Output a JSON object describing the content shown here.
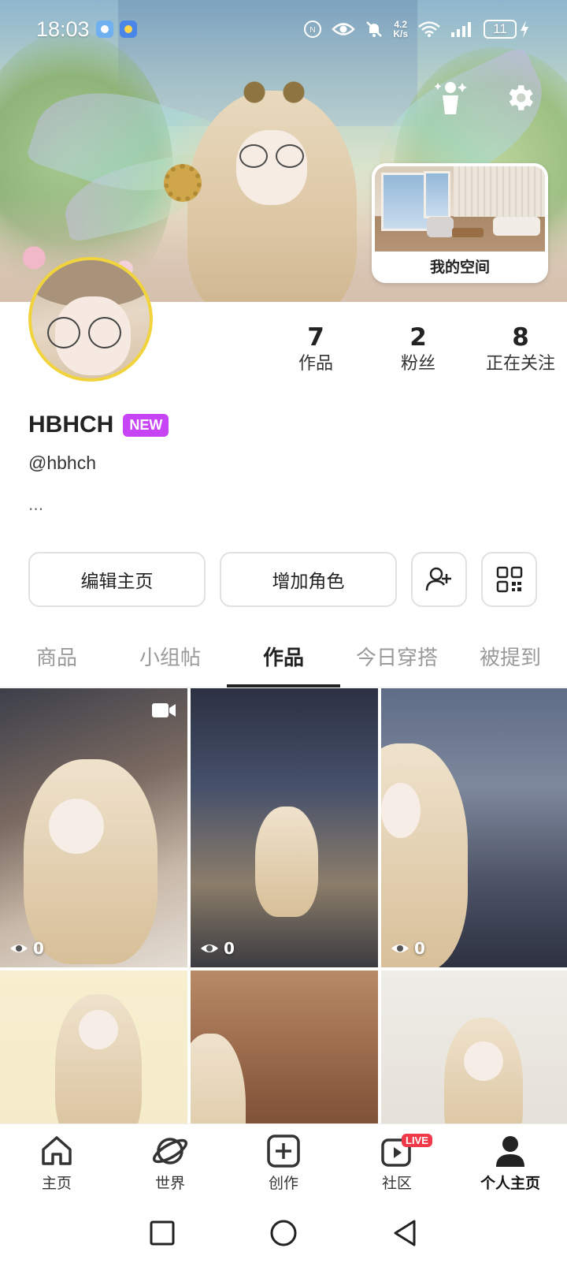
{
  "status_bar": {
    "time": "18:03",
    "net_speed_value": "4.2",
    "net_speed_unit": "K/s",
    "battery": "11"
  },
  "banner": {
    "space_card_label": "我的空间"
  },
  "profile": {
    "stats": [
      {
        "value": "7",
        "label": "作品"
      },
      {
        "value": "2",
        "label": "粉丝"
      },
      {
        "value": "8",
        "label": "正在关注"
      }
    ],
    "name": "HBHCH",
    "badge": "NEW",
    "handle": "@hbhch",
    "bio": "..."
  },
  "actions": {
    "edit_profile": "编辑主页",
    "add_character": "增加角色"
  },
  "tabs": [
    {
      "label": "商品"
    },
    {
      "label": "小组帖"
    },
    {
      "label": "作品",
      "active": true
    },
    {
      "label": "今日穿搭"
    },
    {
      "label": "被提到"
    }
  ],
  "posts": [
    {
      "views": "0",
      "video": true
    },
    {
      "views": "0"
    },
    {
      "views": "0"
    },
    {},
    {},
    {}
  ],
  "bottom_nav": {
    "items": [
      {
        "label": "主页",
        "icon": "home-icon"
      },
      {
        "label": "世界",
        "icon": "planet-icon"
      },
      {
        "label": "创作",
        "icon": "plus-square-icon"
      },
      {
        "label": "社区",
        "icon": "community-icon",
        "badge": "LIVE"
      },
      {
        "label": "个人主页",
        "icon": "user-icon",
        "active": true
      }
    ]
  },
  "colors": {
    "accent_badge": "#c644f5",
    "live_badge": "#f03a4a",
    "avatar_ring": "#f1d33b"
  }
}
